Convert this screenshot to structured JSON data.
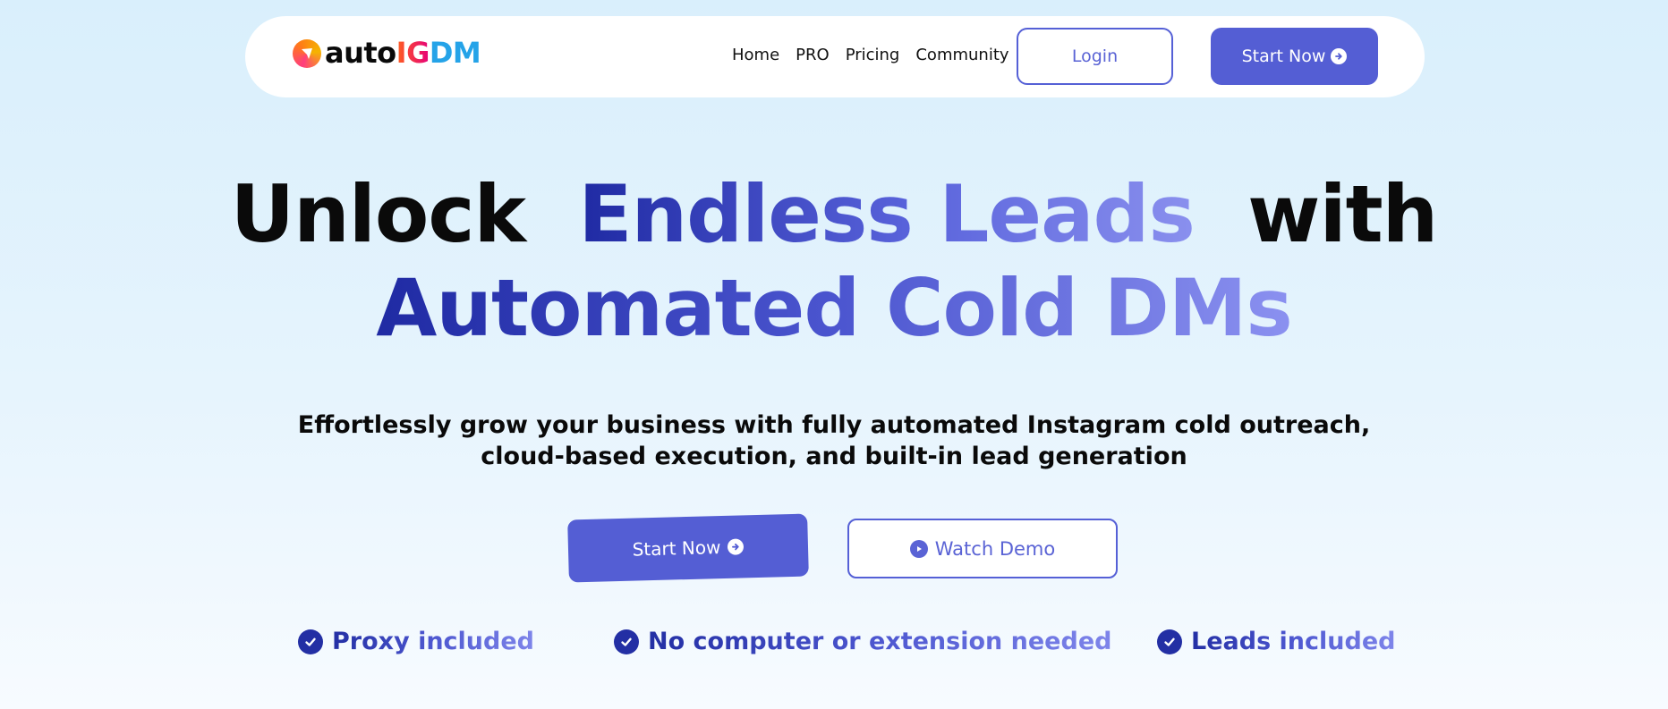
{
  "nav": {
    "logo": {
      "part1": "auto",
      "part2": "IG",
      "part3": "DM"
    },
    "links": [
      "Home",
      "PRO",
      "Pricing",
      "Community"
    ],
    "login_label": "Login",
    "start_label": "Start Now"
  },
  "hero": {
    "line1_a": "Unlock",
    "line1_b": "Endless Leads",
    "line1_c": "with",
    "line2": "Automated Cold DMs",
    "subhead_line1": "Effortlessly grow your business with fully automated Instagram cold outreach,",
    "subhead_line2": "cloud-based execution, and built-in lead generation",
    "start_label": "Start Now",
    "demo_label": "Watch Demo"
  },
  "features": [
    "Proxy included",
    "No computer or extension needed",
    "Leads included"
  ],
  "colors": {
    "accent": "#545ed4",
    "check": "#232fa4",
    "background": "#d9effc"
  },
  "icons": {
    "logo": "send-icon",
    "button_arrow": "arrow-circle-right-icon",
    "demo": "play-circle-icon",
    "feature": "check-circle-icon"
  }
}
